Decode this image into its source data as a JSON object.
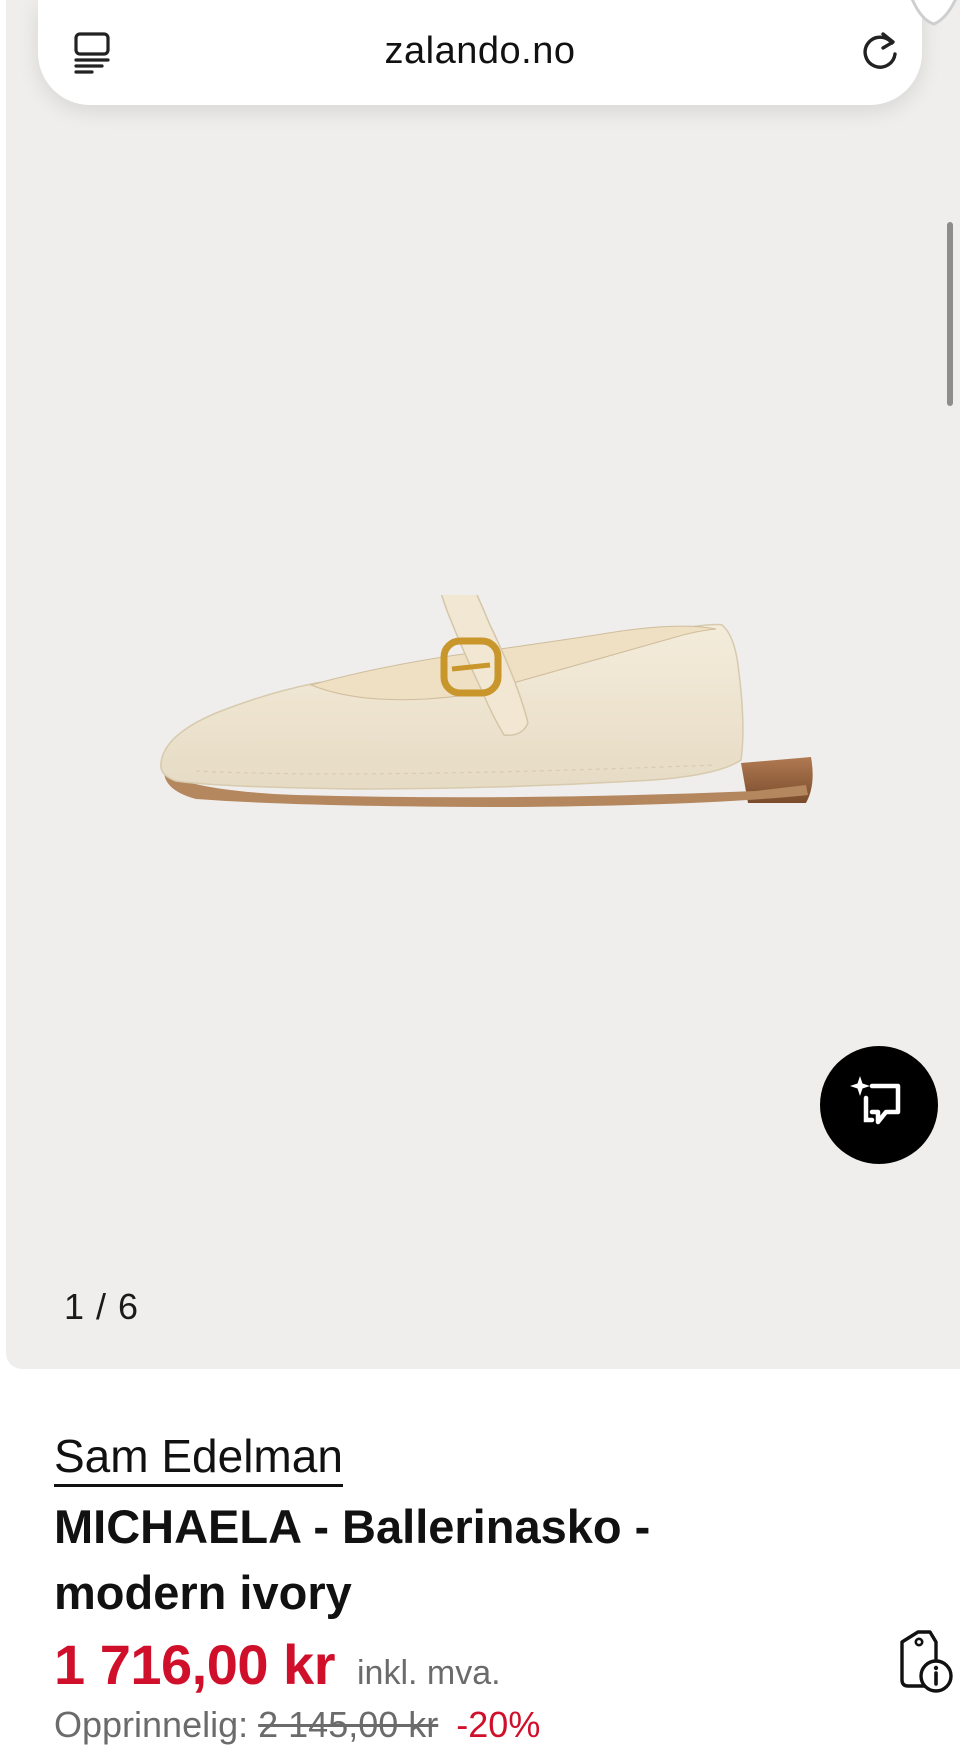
{
  "browser": {
    "url": "zalando.no",
    "menu_icon": "reader-menu-icon",
    "refresh_icon": "refresh-icon"
  },
  "gallery": {
    "counter": "1 / 6",
    "background_color": "#efeeec",
    "ai_button_icon": "sparkle-crop-icon"
  },
  "product": {
    "brand": "Sam Edelman",
    "title": "MICHAELA - Ballerinasko - modern ivory",
    "price": "1 716,00 kr",
    "vat_note": "inkl. mva.",
    "original_label": "Opprinnelig:",
    "original_price": "2 145,00 kr",
    "discount": "-20%",
    "price_color": "#d0102b",
    "price_tag_icon": "price-tag-info-icon"
  }
}
